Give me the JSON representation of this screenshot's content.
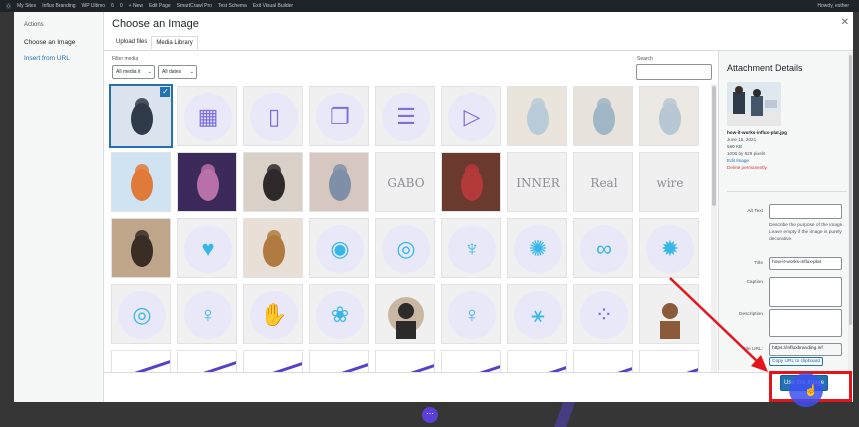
{
  "admin_bar": {
    "items": [
      "My Sites",
      "Influx Branding",
      "WP Ultimo",
      "6",
      "0",
      "+ New",
      "Edit Page",
      "SmartCrawl Pro",
      "Test Schema",
      "Exit Visual Builder"
    ],
    "howdy": "Howdy, esther"
  },
  "modal": {
    "title": "Choose an Image",
    "close_icon": "close-icon",
    "menu": {
      "heading": "Actions",
      "items": [
        "Choose an Image",
        "Insert from URL"
      ]
    },
    "tabs": [
      "Upload files",
      "Media Library"
    ],
    "active_tab": "Media Library",
    "filter": {
      "label": "Filter media",
      "type_value": "All media it",
      "date_value": "All dates"
    },
    "search": {
      "label": "Search",
      "placeholder": ""
    },
    "grid": [
      [
        "photo-business",
        "icon-devices",
        "icon-mobile",
        "icon-windows",
        "icon-document",
        "icon-video",
        "photo-beach-1",
        "photo-beach-2",
        "photo-beach-3"
      ],
      [
        "photo-signpost",
        "photo-sunset",
        "photo-woman-hat",
        "photo-sea",
        "logo-gabo",
        "photo-woman-hat2",
        "logo-inner",
        "logo-realwave",
        "logo-wire"
      ],
      [
        "photo-man-smile",
        "icon-heart-lock",
        "photo-woman-hair",
        "icon-mirror",
        "icon-glasses",
        "icon-yoga-legs",
        "icon-spark",
        "icon-link",
        "icon-sun"
      ],
      [
        "icon-target",
        "icon-meditation",
        "icon-hamsa",
        "icon-lotus",
        "photo-man-circle",
        "icon-yoga-pose",
        "icon-yoga-stretch",
        "pattern-dots",
        "photo-man-shirt"
      ],
      [
        "icon-purple-1",
        "icon-purple-2",
        "icon-purple-3",
        "icon-purple-4",
        "icon-purple-5",
        "icon-purple-6",
        "icon-purple-7",
        "icon-purple-8",
        "icon-purple-9"
      ]
    ],
    "grid_words": {
      "logo-gabo": "GABO",
      "logo-inner": "INNER",
      "logo-realwave": "Real Wave",
      "logo-wire": "wire"
    },
    "selected_index": 0,
    "details": {
      "heading": "Attachment Details",
      "filename": "how-it-works-influx-plat.jpg",
      "date": "June 15, 2021",
      "size": "580 KB",
      "dimensions": "1000 by 829 pixels",
      "edit_link": "Edit Image",
      "delete_link": "Delete permanently",
      "alt_label": "Alt Text",
      "alt_value": "",
      "alt_help": "Describe the purpose of the image. Leave empty if the image is purely decorative.",
      "title_label": "Title",
      "title_value": "how-it-works-influx-plat",
      "caption_label": "Caption",
      "caption_value": "",
      "description_label": "Description",
      "description_value": "",
      "url_label": "File URL:",
      "url_value": "https://influxbranding.inf",
      "copy_label": "Copy URL to clipboard"
    },
    "use_button": "Use this Image"
  },
  "colors": {
    "accent": "#2271b1",
    "highlight": "#e3151a",
    "cursor": "#3c50f0",
    "icon_purple": "#7a6fe0"
  }
}
